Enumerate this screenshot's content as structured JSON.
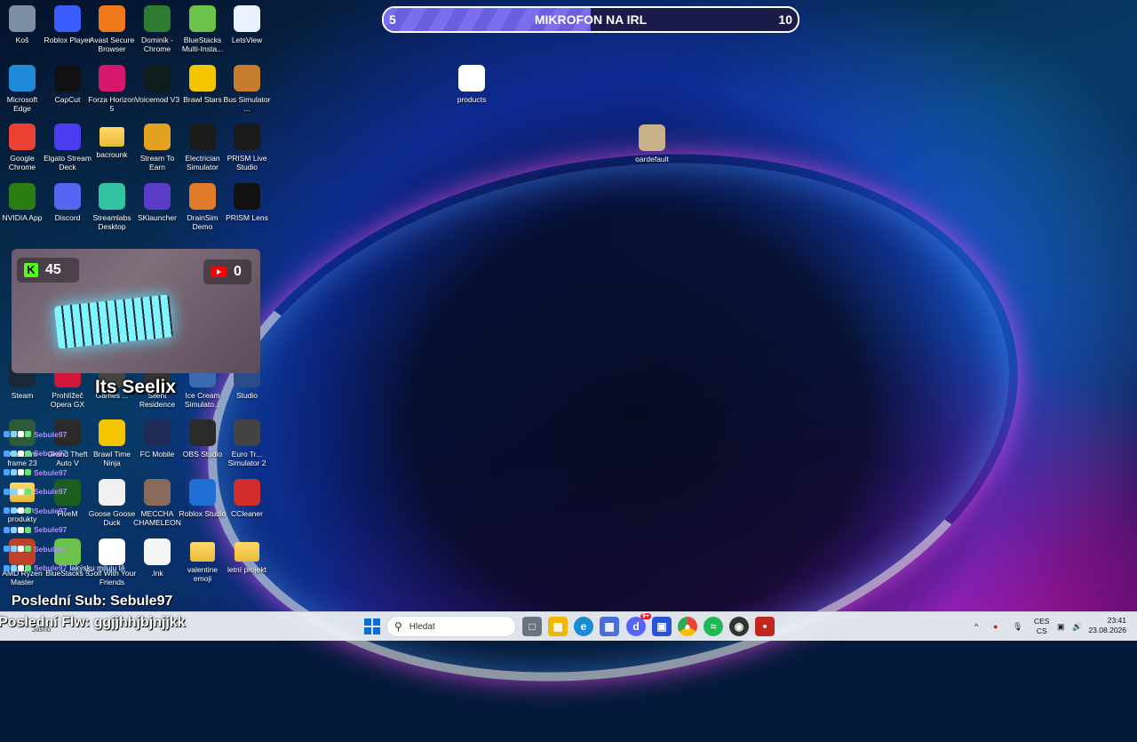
{
  "desktop": {
    "icons": [
      {
        "label": "Koš",
        "icon": "recycle-bin-icon",
        "color": "#7d8fa5"
      },
      {
        "label": "Roblox Player",
        "icon": "roblox-icon",
        "color": "#3b5cff"
      },
      {
        "label": "Avast Secure Browser",
        "icon": "avast-icon",
        "color": "#f07a1a"
      },
      {
        "label": "Dominik - Chrome",
        "icon": "chrome-icon",
        "color": "#2e7d32"
      },
      {
        "label": "BlueStacks Multi-Insta...",
        "icon": "bluestacks-icon",
        "color": "#6cc24a"
      },
      {
        "label": "LetsView",
        "icon": "letsview-icon",
        "color": "#e9f0ff"
      },
      {
        "label": "Microsoft Edge",
        "icon": "edge-icon",
        "color": "#1f8ad8"
      },
      {
        "label": "CapCut",
        "icon": "capcut-icon",
        "color": "#111111"
      },
      {
        "label": "Forza Horizon 5",
        "icon": "forza-icon",
        "color": "#d6186d"
      },
      {
        "label": "Voicemod V3",
        "icon": "voicemod-icon",
        "color": "#0f1c1c"
      },
      {
        "label": "Brawl Stars",
        "icon": "brawl-stars-icon",
        "color": "#f5c400"
      },
      {
        "label": "Bus Simulator ...",
        "icon": "bus-simulator-icon",
        "color": "#c77d2e"
      },
      {
        "label": "Google Chrome",
        "icon": "chrome-icon",
        "color": "#e94235"
      },
      {
        "label": "Elgato Stream Deck",
        "icon": "stream-deck-icon",
        "color": "#4b3cf0"
      },
      {
        "label": "bacrounk",
        "icon": "folder-icon",
        "color": "#f1c24d"
      },
      {
        "label": "Stream To Earn",
        "icon": "stream-to-earn-icon",
        "color": "#e3a321"
      },
      {
        "label": "Electrician Simulator",
        "icon": "electrician-simulator-icon",
        "color": "#1b1b1b"
      },
      {
        "label": "PRISM Live Studio",
        "icon": "prism-icon",
        "color": "#1a1a1a"
      },
      {
        "label": "NVIDIA App",
        "icon": "nvidia-icon",
        "color": "#2b7d12"
      },
      {
        "label": "Discord",
        "icon": "discord-icon",
        "color": "#5865f2"
      },
      {
        "label": "Streamlabs Desktop",
        "icon": "streamlabs-icon",
        "color": "#31c3a2"
      },
      {
        "label": "SKlauncher",
        "icon": "sklauncher-icon",
        "color": "#5b3cc7"
      },
      {
        "label": "DrainSim Demo",
        "icon": "drainsim-icon",
        "color": "#e07b2a"
      },
      {
        "label": "PRISM Lens",
        "icon": "prism-lens-icon",
        "color": "#111111"
      },
      {
        "label": "Steam",
        "icon": "steam-icon",
        "color": "#1b2838"
      },
      {
        "label": "Prohlížeč Opera GX",
        "icon": "opera-gx-icon",
        "color": "#d1163a"
      },
      {
        "label": "Games ...",
        "icon": "games-icon",
        "color": "#444444"
      },
      {
        "label": "Silent Residence",
        "icon": "silent-residence-icon",
        "color": "#333333"
      },
      {
        "label": "Ice Cream Simulato...",
        "icon": "ice-cream-icon",
        "color": "#3a6ab0"
      },
      {
        "label": "Studio",
        "icon": "studio-icon",
        "color": "#2a4d8a"
      },
      {
        "label": "Webcam frame 23",
        "icon": "webcam-frame-icon",
        "color": "#2d5a3a"
      },
      {
        "label": "Grand Theft Auto V",
        "icon": "gta-icon",
        "color": "#2a2a2a"
      },
      {
        "label": "Brawl Time Ninja",
        "icon": "brawl-time-ninja-icon",
        "color": "#f5c400"
      },
      {
        "label": "FC Mobile",
        "icon": "fc-mobile-icon",
        "color": "#1f2a55"
      },
      {
        "label": "OBS Studio",
        "icon": "obs-icon",
        "color": "#2a2a2a"
      },
      {
        "label": "Euro Tr... Simulator 2",
        "icon": "ets2-icon",
        "color": "#444444"
      },
      {
        "label": "stream produkty",
        "icon": "folder-icon",
        "color": "#f1c24d"
      },
      {
        "label": "FiveM",
        "icon": "fivem-icon",
        "color": "#1b5e20"
      },
      {
        "label": "Goose Goose Duck",
        "icon": "goose-icon",
        "color": "#f0f0f0"
      },
      {
        "label": "MECCHA CHAMELEON",
        "icon": "meccha-icon",
        "color": "#8a6a5a"
      },
      {
        "label": "Roblox Studio",
        "icon": "roblox-studio-icon",
        "color": "#1f6fd6"
      },
      {
        "label": "CCleaner",
        "icon": "ccleaner-icon",
        "color": "#d12d2d"
      },
      {
        "label": "AMD Ryzen Master",
        "icon": "amd-ryzen-icon",
        "color": "#c1402a"
      },
      {
        "label": "BlueStacks 5",
        "icon": "bluestacks-icon",
        "color": "#6cc24a"
      },
      {
        "label": "Golf With Your Friends",
        "icon": "golf-icon",
        "color": "#ffffff"
      },
      {
        "label": ".lnk",
        "icon": "file-icon",
        "color": "#f5f5f5"
      },
      {
        "label": "valentine emoji",
        "icon": "folder-icon",
        "color": "#f1c24d"
      },
      {
        "label": "letní projekt",
        "icon": "folder-icon",
        "color": "#f1c24d"
      },
      {
        "label": "products",
        "icon": "chrome-html-icon",
        "color": "#ffffff"
      },
      {
        "label": "oardefault",
        "icon": "image-icon",
        "color": "#c8b08a"
      }
    ]
  },
  "goal_bar": {
    "start": "5",
    "title": "MIKROFON NA IRL",
    "end": "10",
    "progress": 0.5
  },
  "webcam": {
    "kick_count": "45",
    "youtube_count": "0",
    "kick_icon": "K",
    "streamer_name": "Its Seelix"
  },
  "chat": {
    "messages": [
      {
        "user": "Sebule97",
        "text": ""
      },
      {
        "user": "Sebule97",
        "text": ""
      },
      {
        "user": "Sebule97",
        "text": ""
      },
      {
        "user": "Sebule97",
        "text": ""
      },
      {
        "user": "Sebule97",
        "text": ""
      },
      {
        "user": "Sebule97",
        "text": ""
      },
      {
        "user": "Sebule97",
        "text": ""
      },
      {
        "user": "Sebule97",
        "text": "lakýsku miluju tě"
      }
    ]
  },
  "overlay": {
    "last_sub": "Poslední Sub: Sebule97",
    "last_follow": "Poslední Flw: ggjjhhjbjnjjkk"
  },
  "taskbar": {
    "weather": "Jasno",
    "search_placeholder": "Hledat",
    "discord_badge": "9+",
    "lang_top": "CES",
    "lang_bottom": "CS",
    "time": "23:41",
    "date": "23.08.2026"
  }
}
